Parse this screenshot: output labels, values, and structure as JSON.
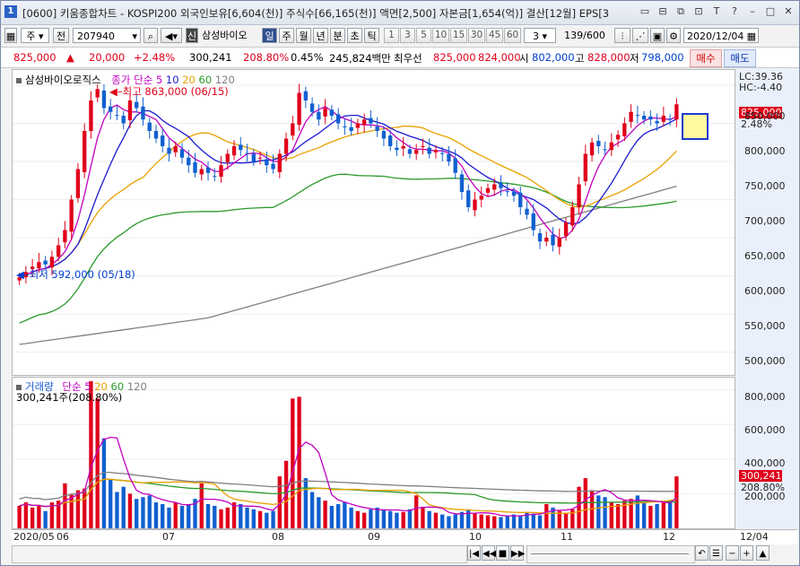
{
  "window": {
    "app_no": "1",
    "title": "[0600] 키움종합차트 - KOSPI200 외국인보유[6,604(천)] 주식수[66,165(천)] 액면[2,500] 자본금[1,654(억)] 결산[12월] EPS[3"
  },
  "toolbar": {
    "period_type": "주",
    "compare": "전",
    "stock_code": "207940",
    "shin": "신",
    "stock_name": "삼성바이오",
    "periods": [
      "일",
      "주",
      "월",
      "년",
      "분",
      "초",
      "틱"
    ],
    "active_period": "일",
    "intervals": [
      "1",
      "3",
      "5",
      "10",
      "15",
      "30",
      "45",
      "60"
    ],
    "interval_select": "3",
    "count": "139/600",
    "date": "2020/12/04"
  },
  "quote": {
    "price": "825,000",
    "change": "20,000",
    "change_pct": "+2.48%",
    "volume": "300,241",
    "volume_ratio": "208.80%",
    "turnover": "0.45%",
    "amount": "245,824백만",
    "best_ask_label": "최우선",
    "best_ask": "825,000",
    "best_bid": "824,000",
    "open_label": "시",
    "open": "802,000",
    "high_label": "고",
    "high": "828,000",
    "low_label": "저",
    "low": "798,000",
    "buy": "매수",
    "sell": "매도"
  },
  "price_panel": {
    "name": "삼성바이오로직스",
    "ma_label": "종가 단순",
    "ma": [
      "5",
      "10",
      "20",
      "60",
      "120"
    ],
    "high_note": "최고 863,000 (06/15)",
    "low_note": "최저 592,000 (05/18)",
    "lc": "LC:39.36",
    "hc": "HC:-4.40",
    "current": "825,000",
    "current_pct": "2.48%",
    "yticks": [
      "850,000",
      "800,000",
      "750,000",
      "700,000",
      "650,000",
      "600,000",
      "550,000",
      "500,000"
    ]
  },
  "volume_panel": {
    "name": "거래량",
    "ma_label": "단순",
    "ma": [
      "5",
      "20",
      "60",
      "120"
    ],
    "current_note": "300,241주(208.80%)",
    "current": "300,241",
    "current_pct": "208.80%",
    "yticks": [
      "800,000",
      "600,000",
      "400,000",
      "200,000"
    ]
  },
  "xaxis": {
    "labels": [
      "2020/05",
      "06",
      "07",
      "08",
      "09",
      "10",
      "11",
      "12"
    ],
    "end_label": "12/04"
  },
  "colors": {
    "up": "#e0001b",
    "down": "#1060d0",
    "ma5": "#c000c0",
    "ma10": "#1a1ad0",
    "ma20": "#e8a000",
    "ma60": "#2a9a2a",
    "ma120": "#808080"
  },
  "chart_data": {
    "type": "candlestick",
    "ohlc_daily_close_approx": [
      598,
      605,
      612,
      618,
      615,
      625,
      640,
      660,
      700,
      740,
      790,
      830,
      845,
      820,
      815,
      810,
      800,
      830,
      820,
      805,
      790,
      780,
      770,
      760,
      770,
      755,
      745,
      735,
      740,
      735,
      730,
      745,
      760,
      770,
      765,
      760,
      750,
      755,
      745,
      740,
      760,
      780,
      800,
      840,
      830,
      815,
      805,
      820,
      810,
      800,
      795,
      790,
      800,
      805,
      800,
      790,
      780,
      770,
      765,
      770,
      760,
      765,
      770,
      760,
      765,
      760,
      750,
      735,
      710,
      690,
      700,
      705,
      715,
      720,
      715,
      710,
      705,
      690,
      680,
      660,
      645,
      650,
      640,
      650,
      670,
      690,
      720,
      760,
      775,
      770,
      765,
      775,
      785,
      800,
      815,
      810,
      805,
      805,
      800,
      810,
      805,
      825
    ],
    "volume_daily_approx": [
      130,
      150,
      120,
      130,
      100,
      150,
      160,
      260,
      200,
      220,
      230,
      850,
      750,
      520,
      280,
      210,
      240,
      200,
      170,
      180,
      190,
      150,
      140,
      120,
      150,
      130,
      140,
      170,
      260,
      140,
      130,
      110,
      120,
      150,
      140,
      120,
      110,
      100,
      90,
      100,
      300,
      390,
      750,
      760,
      290,
      210,
      180,
      160,
      130,
      140,
      150,
      120,
      100,
      90,
      110,
      120,
      110,
      100,
      90,
      95,
      110,
      190,
      120,
      100,
      90,
      80,
      70,
      80,
      95,
      110,
      85,
      80,
      75,
      70,
      65,
      70,
      80,
      75,
      95,
      85,
      75,
      140,
      120,
      100,
      90,
      110,
      240,
      290,
      220,
      190,
      180,
      150,
      140,
      160,
      170,
      190,
      150,
      130,
      140,
      150,
      160,
      300
    ],
    "ylim_price": [
      470000,
      870000
    ],
    "ylim_volume": [
      0,
      850000
    ]
  }
}
